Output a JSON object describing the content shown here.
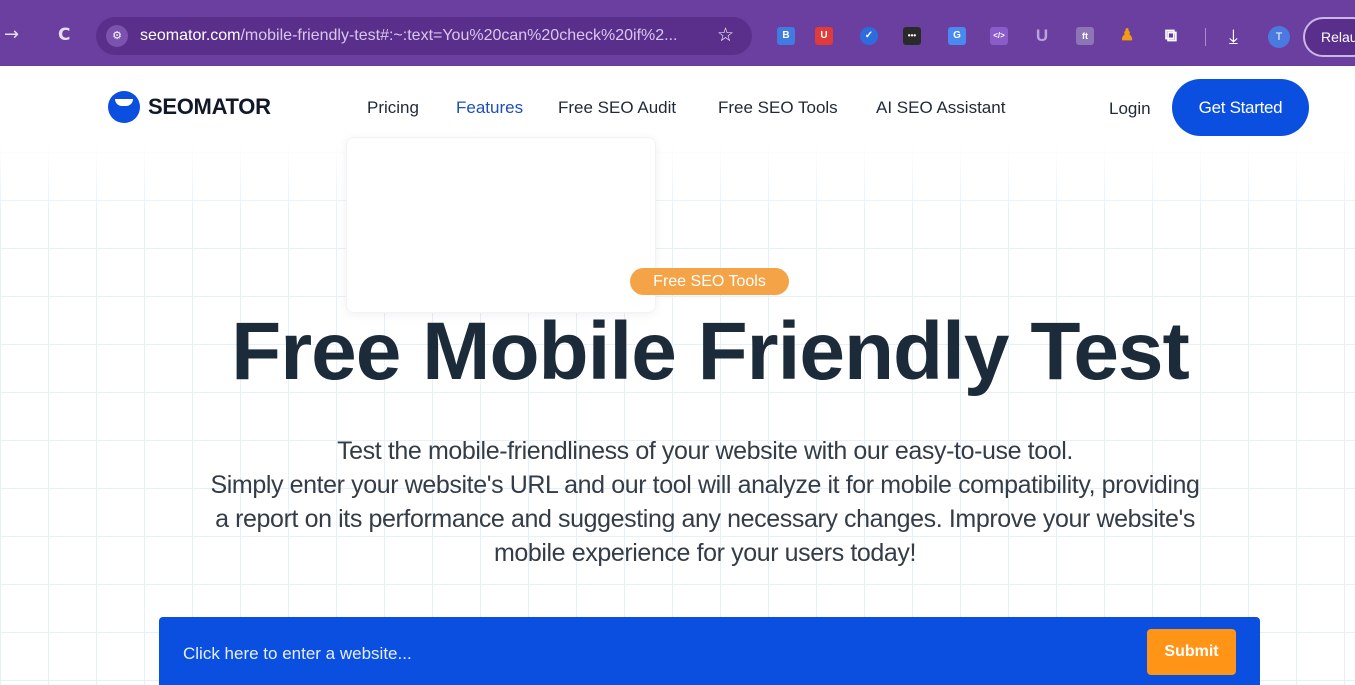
{
  "browser": {
    "back_icon": "→",
    "reload_icon": "C",
    "site_info_icon": "tune-icon",
    "url_host": "seomator.com",
    "url_path": "/mobile-friendly-test#:~:text=You%20can%20check%20if%2...",
    "bookmark_icon": "☆",
    "extensions": [
      {
        "name": "ext-blue-square-icon",
        "glyph": "B",
        "color": "#3f7be0"
      },
      {
        "name": "ext-red-shield-icon",
        "glyph": "U",
        "color": "#e03a3a"
      },
      {
        "name": "ext-blue-check-icon",
        "glyph": "✓",
        "color": "#2d6cdf"
      },
      {
        "name": "ext-dots-icon",
        "glyph": "•••",
        "color": "#2a2a2a"
      },
      {
        "name": "ext-translate-icon",
        "glyph": "G",
        "color": "#4a8af0"
      },
      {
        "name": "ext-code-icon",
        "glyph": "</>",
        "color": "#8a5cc9"
      },
      {
        "name": "ext-u-icon",
        "glyph": "U",
        "color": "#7a58b0"
      },
      {
        "name": "ext-font-icon",
        "glyph": "ft",
        "color": "#8c76b6"
      },
      {
        "name": "ext-person-icon",
        "glyph": "♟",
        "color": "#e67e22"
      },
      {
        "name": "ext-puzzle-icon",
        "glyph": "⧉",
        "color": "#6b3fa0"
      }
    ],
    "download_icon": "⤓",
    "profile_initial": "T",
    "relaunch_label": "Relau"
  },
  "header": {
    "logo_text": "SEOMATOR",
    "nav": [
      {
        "label": "Pricing"
      },
      {
        "label": "Features"
      },
      {
        "label": "Free SEO Audit"
      },
      {
        "label": "Free SEO Tools"
      },
      {
        "label": "AI SEO Assistant"
      }
    ],
    "login_label": "Login",
    "cta_label": "Get Started"
  },
  "hero": {
    "badge": "Free SEO Tools",
    "title": "Free Mobile Friendly Test",
    "subtitle_lines": [
      "Test the mobile-friendliness of your website with our easy-to-use tool.",
      "Simply enter your website's URL and our tool will analyze it for mobile compatibility, providing",
      "a report on its performance and suggesting any necessary changes. Improve your website's",
      "mobile experience for your users today!"
    ]
  },
  "form": {
    "input_placeholder": "Click here to enter a website...",
    "submit_label": "Submit"
  },
  "colors": {
    "brand_blue": "#0a4fe0",
    "badge_orange": "#f5a347",
    "submit_orange": "#ff9416",
    "browser_purple": "#6b3fa0"
  }
}
